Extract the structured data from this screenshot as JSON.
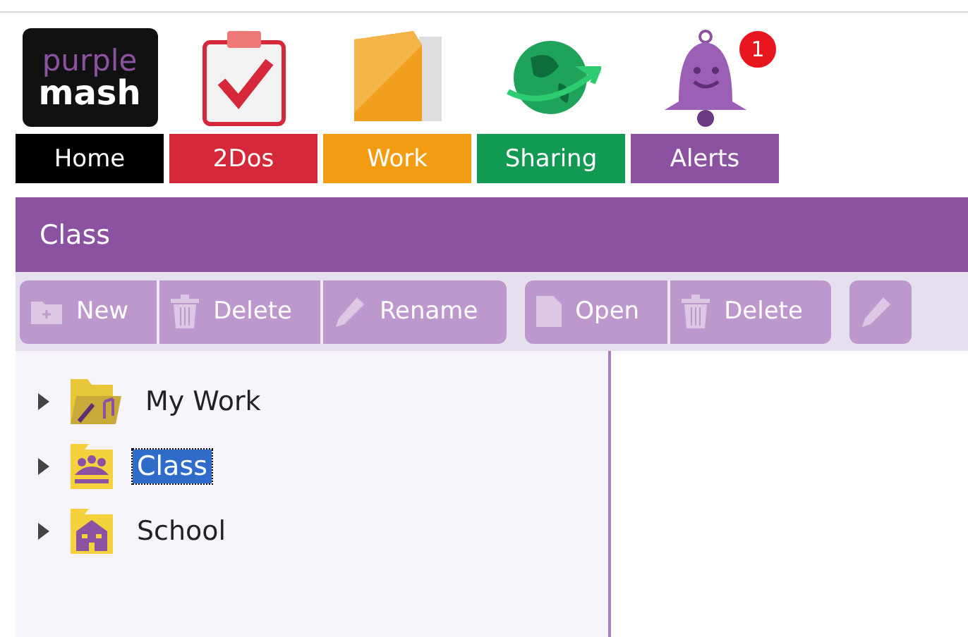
{
  "logo": {
    "line_1": "purple",
    "line_2": "mash"
  },
  "nav": [
    {
      "kind": "home",
      "label": "Home",
      "color": "#000000"
    },
    {
      "kind": "todo",
      "label": "2Dos",
      "color": "#d5293b"
    },
    {
      "kind": "work",
      "label": "Work",
      "color": "#f39c12"
    },
    {
      "kind": "sharing",
      "label": "Sharing",
      "color": "#129a52"
    },
    {
      "kind": "alerts",
      "label": "Alerts",
      "color": "#8b52a1",
      "badge": "1"
    }
  ],
  "panel": {
    "title": "Class"
  },
  "toolbar_groups": [
    [
      {
        "kind": "new",
        "label": "New"
      },
      {
        "kind": "delete",
        "label": "Delete"
      },
      {
        "kind": "rename",
        "label": "Rename"
      }
    ],
    [
      {
        "kind": "open",
        "label": "Open"
      },
      {
        "kind": "delete",
        "label": "Delete"
      }
    ],
    [
      {
        "kind": "rename"
      }
    ]
  ],
  "tree": [
    {
      "kind": "work",
      "label": "My Work",
      "selected": false,
      "expanded": false
    },
    {
      "kind": "class",
      "label": "Class",
      "selected": true,
      "expanded": false
    },
    {
      "kind": "school",
      "label": "School",
      "selected": false,
      "expanded": false
    }
  ]
}
